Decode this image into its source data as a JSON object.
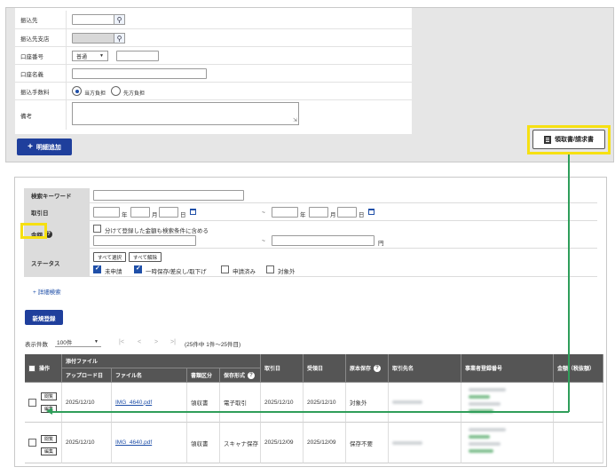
{
  "top_form": {
    "rows": [
      {
        "label": "振込先"
      },
      {
        "label": "振込先支店"
      },
      {
        "label": "口座番号",
        "select_value": "普通"
      },
      {
        "label": "口座名義"
      },
      {
        "label": "振込手数料",
        "options": [
          "当方負担",
          "先方負担"
        ],
        "selected": "当方負担"
      },
      {
        "label": "備考"
      }
    ],
    "add_button": "明細追加",
    "receipt_button": "領取書/請求書"
  },
  "search": {
    "keyword_label": "検索キーワード",
    "date_label": "取引日",
    "amount_label": "金額",
    "amount_checkbox": "分けて登録した金額も検索条件に含める",
    "status_label": "ステータス",
    "year": "年",
    "month": "月",
    "day": "日",
    "tilde": "~",
    "yen": "円",
    "select_all": "すべて選択",
    "clear_all": "すべて解除",
    "statuses": [
      {
        "label": "未申請",
        "checked": true
      },
      {
        "label": "一時保存/差戻し/取下げ",
        "checked": true
      },
      {
        "label": "申請済み",
        "checked": false
      },
      {
        "label": "対象外",
        "checked": false
      }
    ],
    "detail_link": "+ 詳細検索"
  },
  "new_button": "新規登録",
  "pager": {
    "label": "表示件数",
    "per_page": "100件",
    "nav": [
      "|<",
      "<",
      ">",
      ">|"
    ],
    "count_text": "(25件中 1件〜25件目)"
  },
  "table": {
    "headers": {
      "ops": "操作",
      "attach": "添付ファイル",
      "upload_date": "アップロード日",
      "file_name": "ファイル名",
      "doc_type": "書類区分",
      "save_format": "保存形式",
      "deal_date": "取引日",
      "receipt_date": "受領日",
      "original_save": "原本保存",
      "partner": "取引先名",
      "reg_number": "事業者登録番号",
      "amount": "金額（税抜額）"
    },
    "row_buttons": {
      "view": "閲覧",
      "edit": "編集"
    },
    "rows": [
      {
        "upload_date": "2025/12/10",
        "file_name": "IMG_4640.pdf",
        "doc_type": "領収書",
        "save_format": "電子取引",
        "deal_date": "2025/12/10",
        "receipt_date": "2025/12/10",
        "original_save": "対象外"
      },
      {
        "upload_date": "2025/12/10",
        "file_name": "IMG_4640.pdf",
        "doc_type": "領収書",
        "save_format": "スキャナ保存",
        "deal_date": "2025/12/09",
        "receipt_date": "2025/12/09",
        "original_save": "保存不要"
      }
    ]
  },
  "colors": {
    "accent": "#1f3f9c",
    "highlight": "#f6e012",
    "arrow": "#2f9e5a",
    "header_bg": "#555555"
  }
}
